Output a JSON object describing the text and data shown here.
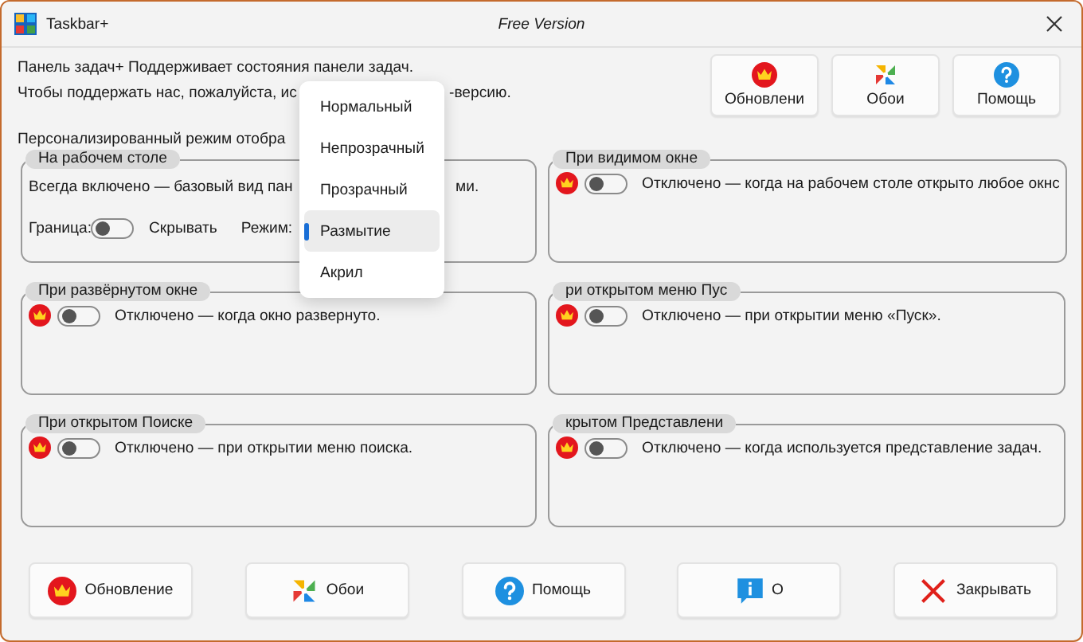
{
  "window": {
    "title": "Taskbar+",
    "edition": "Free Version"
  },
  "intro": {
    "line_1": "Панель задач+ Поддерживает состояния панели задач.",
    "line_2_start": "Чтобы поддержать нас, пожалуйста, ис",
    "line_2_end": "-версию.",
    "mode_heading": "Персонализированный режим отобра"
  },
  "top_buttons": [
    {
      "kind": "update",
      "label": "Обновлени"
    },
    {
      "kind": "wallpaper",
      "label": "Обои"
    },
    {
      "kind": "help",
      "label": "Помощь"
    }
  ],
  "groups": [
    {
      "kind": "desktop",
      "legend": "На рабочем столе",
      "description_start": "Всегда включено — базовый вид пан",
      "description_end": "ми.",
      "border_label": "Граница:",
      "border_toggle": {
        "on": false
      },
      "hide_label": "Скрывать",
      "mode_label": "Режим:"
    },
    {
      "kind": "state",
      "legend": "При видимом окне",
      "premium": true,
      "toggle": {
        "on": false
      },
      "description": "Отключено — когда на рабочем столе открыто любое окнс"
    },
    {
      "kind": "state",
      "legend": "При развёрнутом окне",
      "premium": true,
      "toggle": {
        "on": false
      },
      "description": "Отключено — когда окно развернуто."
    },
    {
      "kind": "state",
      "legend": "ри открытом меню Пус",
      "premium": true,
      "toggle": {
        "on": false
      },
      "description": "Отключено — при открытии меню «Пуск»."
    },
    {
      "kind": "state",
      "legend": "При открытом Поиске",
      "premium": true,
      "toggle": {
        "on": false
      },
      "description": "Отключено — при открытии меню поиска."
    },
    {
      "kind": "state",
      "legend": "крытом Представлени",
      "premium": true,
      "toggle": {
        "on": false
      },
      "description": "Отключено — когда используется представление задач."
    }
  ],
  "mode_menu": {
    "items": [
      {
        "label": "Нормальный",
        "selected": false
      },
      {
        "label": "Непрозрачный",
        "selected": false
      },
      {
        "label": "Прозрачный",
        "selected": false
      },
      {
        "label": "Размытие",
        "selected": true
      },
      {
        "label": "Акрил",
        "selected": false
      }
    ]
  },
  "bottom_buttons": [
    {
      "kind": "update",
      "label": "Обновление"
    },
    {
      "kind": "wallpaper",
      "label": "Обои"
    },
    {
      "kind": "help",
      "label": "Помощь"
    },
    {
      "kind": "about",
      "label": "О"
    },
    {
      "kind": "close",
      "label": "Закрывать"
    }
  ]
}
